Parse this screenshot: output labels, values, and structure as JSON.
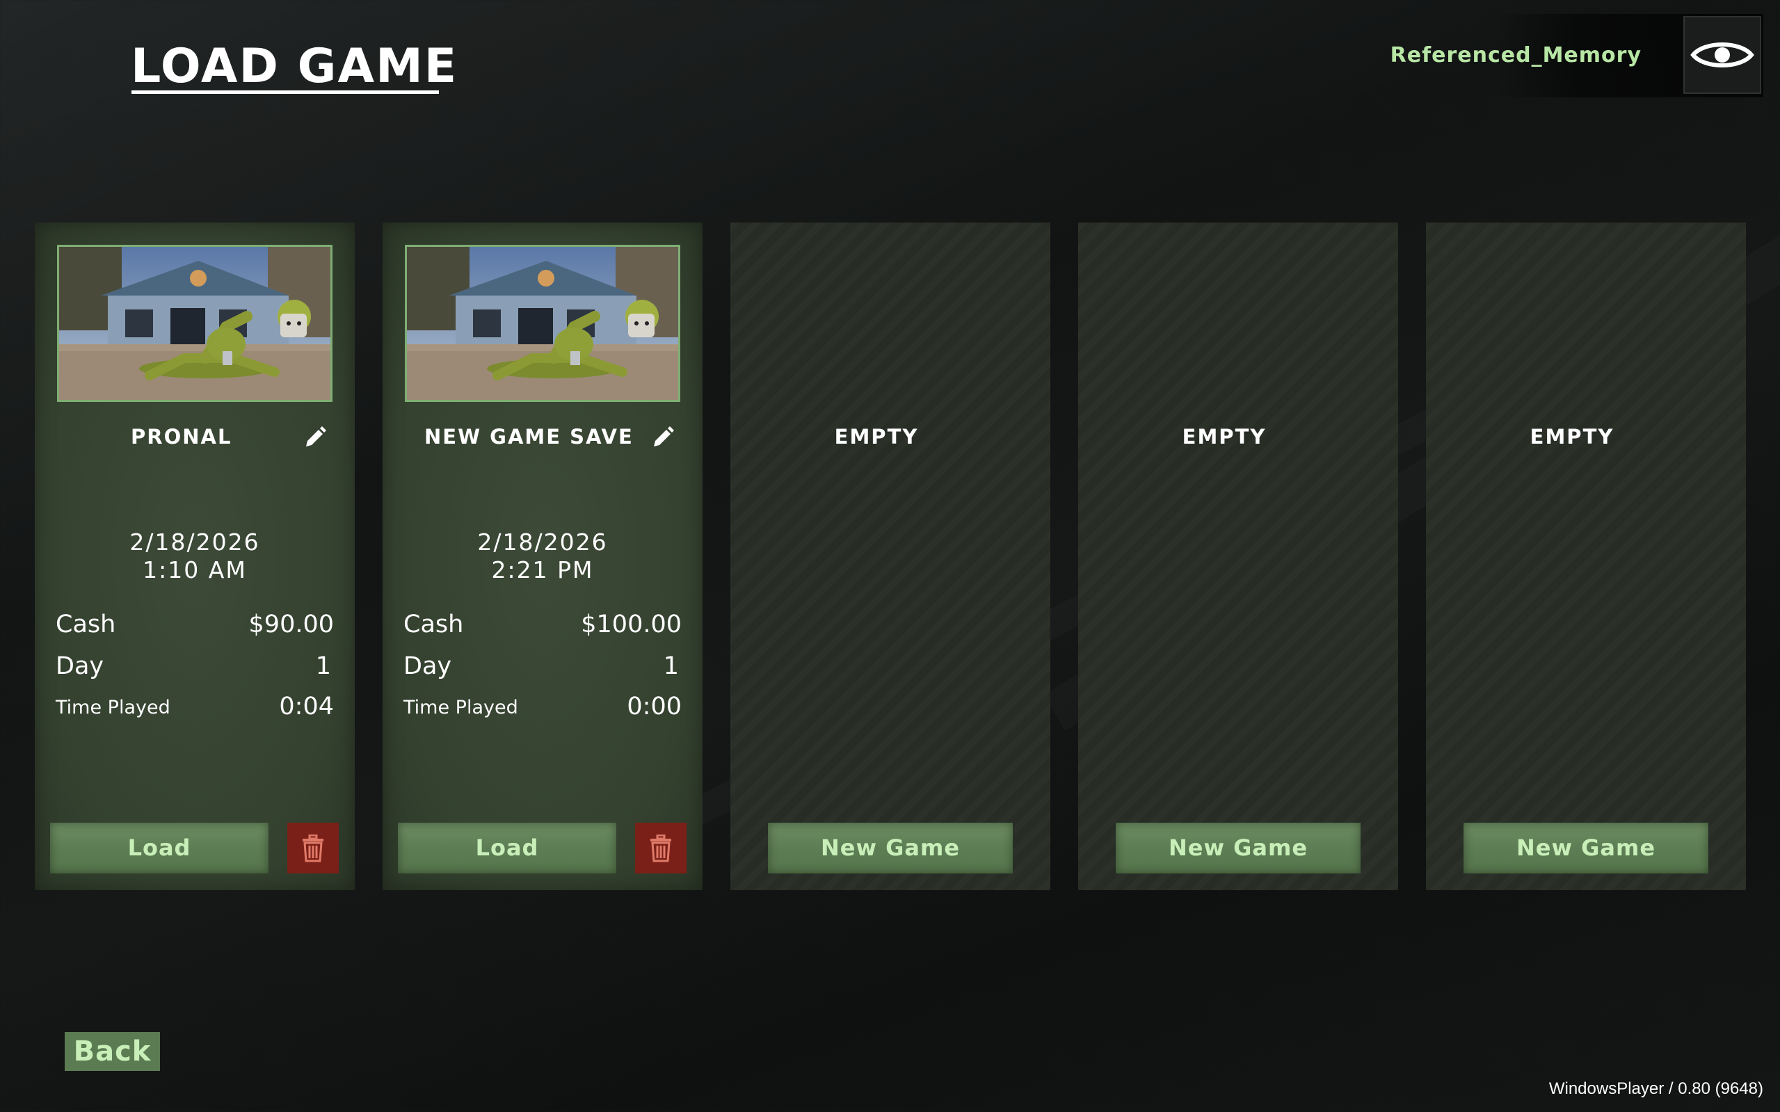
{
  "header": {
    "title": "LOAD GAME",
    "username": "Referenced_Memory",
    "profile_icon": "eye-icon"
  },
  "slots": [
    {
      "state": "filled",
      "name": "PRONAL",
      "date": "2/18/2026",
      "time": "1:10 AM",
      "cash_label": "Cash",
      "cash": "$90.00",
      "day_label": "Day",
      "day": "1",
      "time_played_label": "Time Played",
      "time_played": "0:04",
      "load_label": "Load"
    },
    {
      "state": "filled",
      "name": "NEW GAME SAVE",
      "date": "2/18/2026",
      "time": "2:21 PM",
      "cash_label": "Cash",
      "cash": "$100.00",
      "day_label": "Day",
      "day": "1",
      "time_played_label": "Time Played",
      "time_played": "0:00",
      "load_label": "Load"
    },
    {
      "state": "empty",
      "label": "EMPTY",
      "new_game_label": "New Game"
    },
    {
      "state": "empty",
      "label": "EMPTY",
      "new_game_label": "New Game"
    },
    {
      "state": "empty",
      "label": "EMPTY",
      "new_game_label": "New Game"
    }
  ],
  "footer": {
    "back_label": "Back",
    "version": "WindowsPlayer / 0.80 (9648)"
  },
  "colors": {
    "accent_text": "#b8e6a5",
    "button_green": "#5d7d54",
    "delete_red": "#7a2018",
    "slot_filled": "#3a4735",
    "slot_empty": "#272c24"
  }
}
